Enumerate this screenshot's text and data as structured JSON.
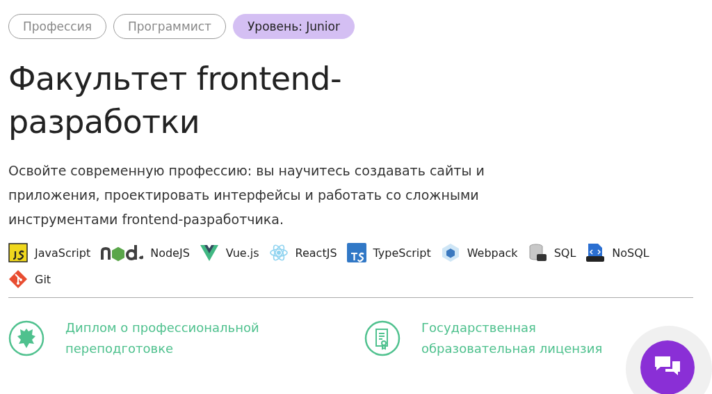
{
  "tags": [
    {
      "label": "Профессия",
      "kind": "outline"
    },
    {
      "label": "Программист",
      "kind": "outline"
    },
    {
      "label": "Уровень: Junior",
      "kind": "filled"
    }
  ],
  "title": "Факультет frontend-разработки",
  "description": "Освойте современную профессию: вы научитесь создавать сайты и приложения, проектировать интерфейсы и работать со сложными инструментами frontend-разработчика.",
  "technologies": [
    {
      "name": "JavaScript",
      "kind": "js"
    },
    {
      "name": "NodeJS",
      "kind": "node"
    },
    {
      "name": "Vue.js",
      "kind": "vue"
    },
    {
      "name": "ReactJS",
      "kind": "react"
    },
    {
      "name": "TypeScript",
      "kind": "ts"
    },
    {
      "name": "Webpack",
      "kind": "webpack"
    },
    {
      "name": "SQL",
      "kind": "sql"
    },
    {
      "name": "NoSQL",
      "kind": "nosql"
    },
    {
      "name": "Git",
      "kind": "git"
    }
  ],
  "features": [
    {
      "text": "Диплом о профессиональной переподготовке",
      "kind": "emblem"
    },
    {
      "text": "Государственная образовательная лицензия",
      "kind": "certificate"
    }
  ]
}
